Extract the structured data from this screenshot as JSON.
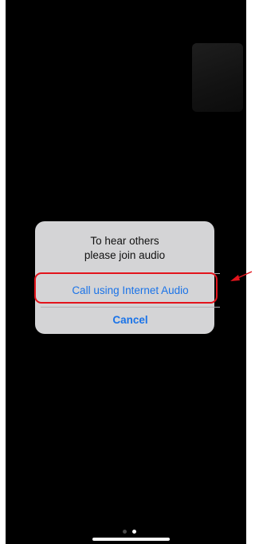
{
  "dialog": {
    "message_line1": "To hear others",
    "message_line2": "please join audio",
    "primary_action": "Call using Internet Audio",
    "cancel_action": "Cancel"
  },
  "pagination": {
    "total_pages": 2,
    "current_page": 2
  },
  "colors": {
    "screen_background": "#000000",
    "dialog_background": "#d4d4d6",
    "action_text": "#1a73e8",
    "annotation": "#e3141c"
  },
  "icons": {
    "annotation_arrow": "arrow-icon"
  }
}
